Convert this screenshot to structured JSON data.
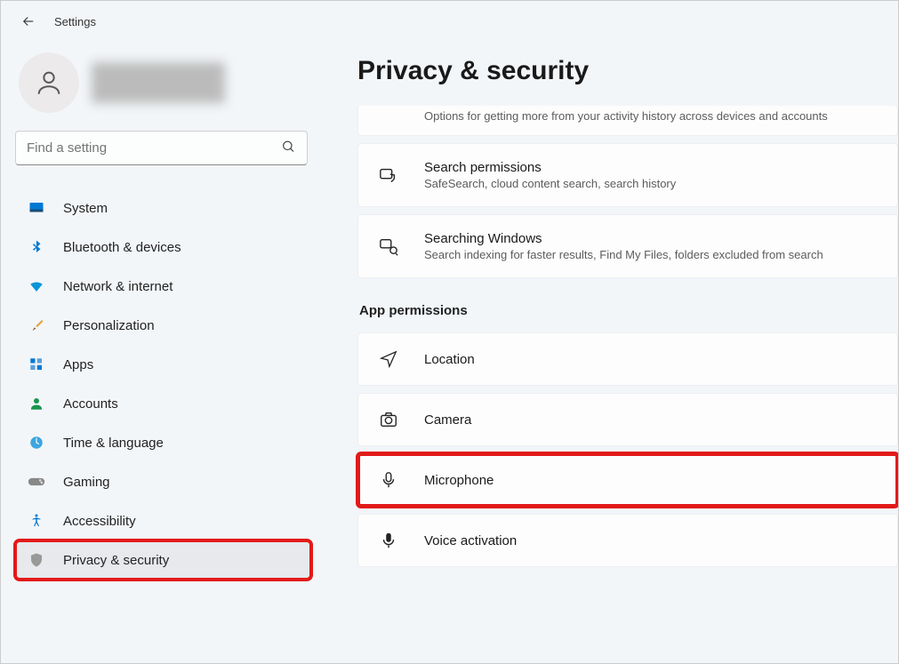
{
  "header": {
    "title": "Settings"
  },
  "search": {
    "placeholder": "Find a setting"
  },
  "nav": {
    "items": [
      {
        "label": "System"
      },
      {
        "label": "Bluetooth & devices"
      },
      {
        "label": "Network & internet"
      },
      {
        "label": "Personalization"
      },
      {
        "label": "Apps"
      },
      {
        "label": "Accounts"
      },
      {
        "label": "Time & language"
      },
      {
        "label": "Gaming"
      },
      {
        "label": "Accessibility"
      },
      {
        "label": "Privacy & security"
      }
    ]
  },
  "page": {
    "title": "Privacy & security",
    "clipped": {
      "desc": "Options for getting more from your activity history across devices and accounts"
    },
    "cards": [
      {
        "title": "Search permissions",
        "desc": "SafeSearch, cloud content search, search history"
      },
      {
        "title": "Searching Windows",
        "desc": "Search indexing for faster results, Find My Files, folders excluded from search"
      }
    ],
    "section": "App permissions",
    "perms": [
      {
        "title": "Location"
      },
      {
        "title": "Camera"
      },
      {
        "title": "Microphone"
      },
      {
        "title": "Voice activation"
      }
    ]
  }
}
